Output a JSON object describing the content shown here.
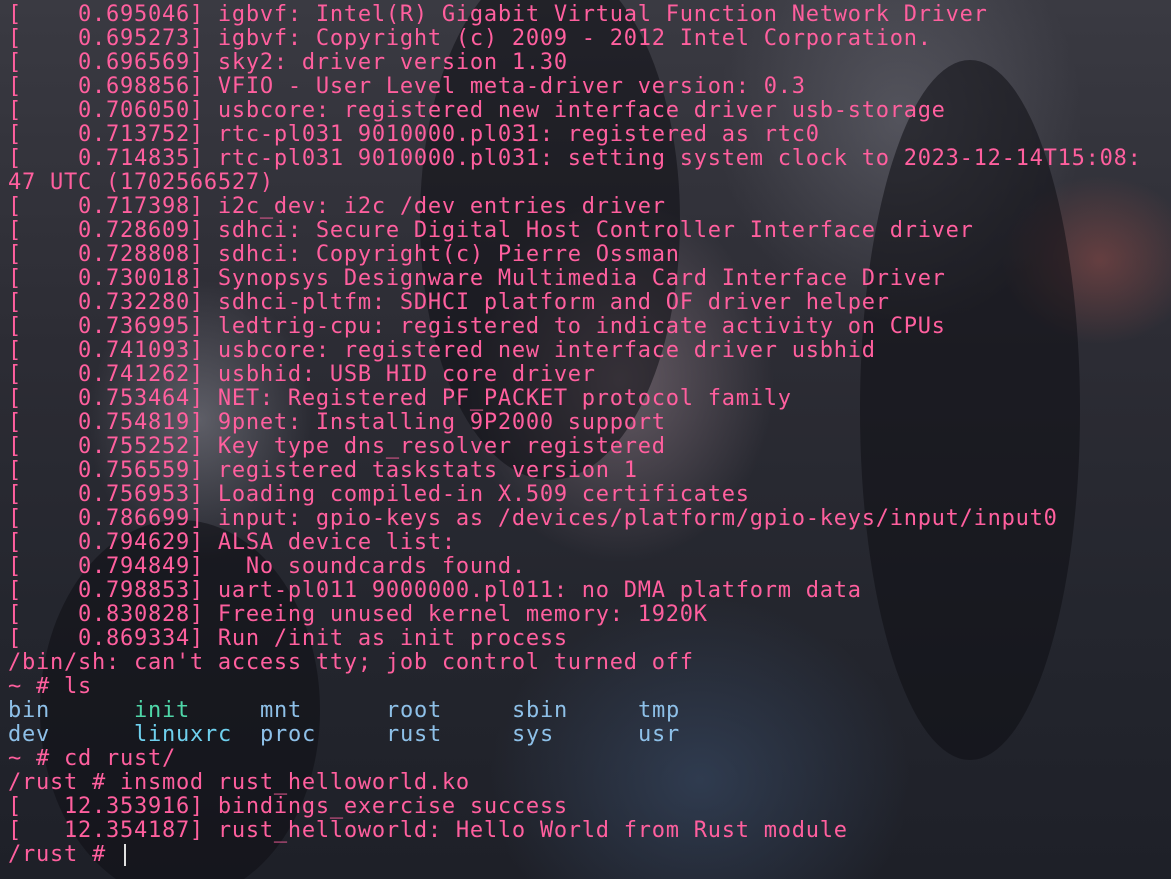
{
  "boot_log": [
    {
      "ts": "[    0.695046]",
      "msg": " igbvf: Intel(R) Gigabit Virtual Function Network Driver"
    },
    {
      "ts": "[    0.695273]",
      "msg": " igbvf: Copyright (c) 2009 - 2012 Intel Corporation."
    },
    {
      "ts": "[    0.696569]",
      "msg": " sky2: driver version 1.30"
    },
    {
      "ts": "[    0.698856]",
      "msg": " VFIO - User Level meta-driver version: 0.3"
    },
    {
      "ts": "[    0.706050]",
      "msg": " usbcore: registered new interface driver usb-storage"
    },
    {
      "ts": "[    0.713752]",
      "msg": " rtc-pl031 9010000.pl031: registered as rtc0"
    },
    {
      "ts": "[    0.714835]",
      "msg": " rtc-pl031 9010000.pl031: setting system clock to 2023-12-14T15:08:"
    },
    {
      "ts": "",
      "msg": "47 UTC (1702566527)"
    },
    {
      "ts": "[    0.717398]",
      "msg": " i2c_dev: i2c /dev entries driver"
    },
    {
      "ts": "[    0.728609]",
      "msg": " sdhci: Secure Digital Host Controller Interface driver"
    },
    {
      "ts": "[    0.728808]",
      "msg": " sdhci: Copyright(c) Pierre Ossman"
    },
    {
      "ts": "[    0.730018]",
      "msg": " Synopsys Designware Multimedia Card Interface Driver"
    },
    {
      "ts": "[    0.732280]",
      "msg": " sdhci-pltfm: SDHCI platform and OF driver helper"
    },
    {
      "ts": "[    0.736995]",
      "msg": " ledtrig-cpu: registered to indicate activity on CPUs"
    },
    {
      "ts": "[    0.741093]",
      "msg": " usbcore: registered new interface driver usbhid"
    },
    {
      "ts": "[    0.741262]",
      "msg": " usbhid: USB HID core driver"
    },
    {
      "ts": "[    0.753464]",
      "msg": " NET: Registered PF_PACKET protocol family"
    },
    {
      "ts": "[    0.754819]",
      "msg": " 9pnet: Installing 9P2000 support"
    },
    {
      "ts": "[    0.755252]",
      "msg": " Key type dns_resolver registered"
    },
    {
      "ts": "[    0.756559]",
      "msg": " registered taskstats version 1"
    },
    {
      "ts": "[    0.756953]",
      "msg": " Loading compiled-in X.509 certificates"
    },
    {
      "ts": "[    0.786699]",
      "msg": " input: gpio-keys as /devices/platform/gpio-keys/input/input0"
    },
    {
      "ts": "[    0.794629]",
      "msg": " ALSA device list:"
    },
    {
      "ts": "[    0.794849]",
      "msg": "   No soundcards found."
    },
    {
      "ts": "[    0.798853]",
      "msg": " uart-pl011 9000000.pl011: no DMA platform data"
    },
    {
      "ts": "[    0.830828]",
      "msg": " Freeing unused kernel memory: 1920K"
    },
    {
      "ts": "[    0.869334]",
      "msg": " Run /init as init process"
    }
  ],
  "shell_warning": "/bin/sh: can't access tty; job control turned off",
  "cmd_ls": "~ # ls",
  "ls_rows": [
    [
      "bin",
      "init",
      "mnt",
      "root",
      "sbin",
      "tmp"
    ],
    [
      "dev",
      "linuxrc",
      "proc",
      "rust",
      "sys",
      "usr"
    ]
  ],
  "cmd_cd": "~ # cd rust/",
  "cmd_insmod": "/rust # insmod rust_helloworld.ko",
  "module_log": [
    {
      "ts": "[   12.353916]",
      "msg": " bindings_exercise success"
    },
    {
      "ts": "[   12.354187]",
      "msg": " rust_helloworld: Hello World from Rust module"
    }
  ],
  "prompt": "/rust # ",
  "colors": {
    "text": "#ff5f9e",
    "dir": "#8ec0e8",
    "exec": "#4fd6a8",
    "link": "#6fd0ee"
  }
}
